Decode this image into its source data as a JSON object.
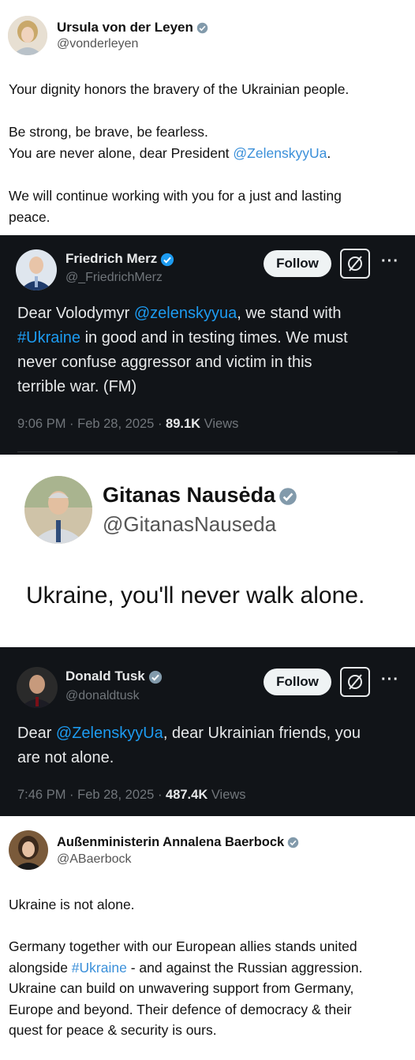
{
  "posts": [
    {
      "author": "Ursula von der Leyen",
      "handle": "@vonderleyen",
      "lines": [
        [
          "Your dignity honors the bravery of the Ukrainian people."
        ],
        [
          ""
        ],
        [
          "Be strong, be brave, be fearless."
        ],
        [
          "You are never alone, dear President ",
          "@ZelenskyyUa",
          "."
        ],
        [
          ""
        ],
        [
          "We will continue working with you for a just and lasting"
        ],
        [
          "peace."
        ]
      ]
    },
    {
      "author": "Friedrich Merz",
      "handle": "@_FriedrichMerz",
      "follow_label": "Follow",
      "lines": [
        [
          "Dear Volodymyr ",
          "@zelenskyyua",
          ", we stand with"
        ],
        [
          "#Ukraine",
          " in good and in testing times. We must"
        ],
        [
          "never confuse aggressor and victim in this"
        ],
        [
          "terrible war. (FM)"
        ]
      ],
      "timestamp": "9:06 PM · Feb 28, 2025 · ",
      "views_count": "89.1K",
      "views_label": " Views"
    },
    {
      "author": "Gitanas Nausėda",
      "handle": "@GitanasNauseda",
      "text": "Ukraine, you'll never walk alone."
    },
    {
      "author": "Donald Tusk",
      "handle": "@donaldtusk",
      "follow_label": "Follow",
      "lines": [
        [
          "Dear ",
          "@ZelenskyyUa",
          ", dear Ukrainian friends, you"
        ],
        [
          "are not alone."
        ]
      ],
      "timestamp": "7:46 PM · Feb 28, 2025 · ",
      "views_count": "487.4K",
      "views_label": " Views"
    },
    {
      "author": "Außenministerin Annalena Baerbock",
      "handle": "@ABaerbock",
      "lines": [
        [
          "Ukraine is not alone."
        ],
        [
          ""
        ],
        [
          "Germany together with our European allies stands united"
        ],
        [
          "alongside ",
          "#Ukraine",
          " - and against the Russian aggression."
        ],
        [
          "Ukraine can build on unwavering support from Germany,"
        ],
        [
          "Europe and beyond. Their defence of democracy & their"
        ],
        [
          "quest for peace & security is ours."
        ]
      ]
    }
  ],
  "colors": {
    "link": "#1d9bf0",
    "dark_bg": "#15202b",
    "verified_blue": "#1d9bf0",
    "verified_gray": "#829aab"
  },
  "icons": {
    "verified": "verified-badge-icon",
    "grok": "grok-icon",
    "more": "more-dots-icon"
  }
}
